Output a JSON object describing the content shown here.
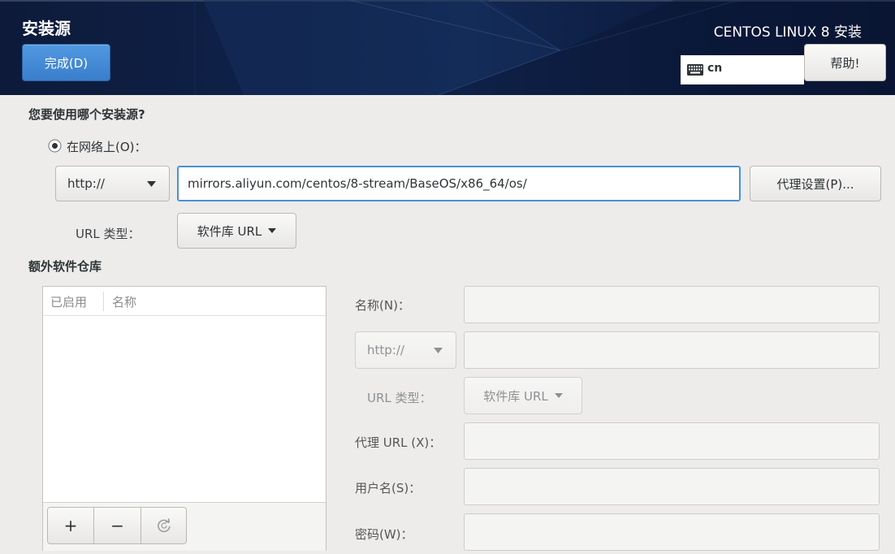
{
  "header": {
    "title": "安装源",
    "done_button": "完成(D)",
    "product_title": "CENTOS LINUX 8 安装",
    "keyboard_layout": "cn",
    "help_button": "帮助!"
  },
  "source": {
    "question": "您要使用哪个安装源?",
    "network_option": {
      "label": "在网络上(O)：",
      "selected": true
    },
    "protocol": "http://",
    "url": "mirrors.aliyun.com/centos/8-stream/BaseOS/x86_64/os/",
    "proxy_button": "代理设置(P)...",
    "url_type_label": "URL 类型：",
    "url_type": "软件库 URL"
  },
  "additional_repos": {
    "title": "额外软件仓库",
    "columns": [
      "已启用",
      "名称"
    ],
    "rows": [],
    "add_button": "+",
    "remove_button": "−"
  },
  "repo_form": {
    "enabled": false,
    "name_label": "名称(N)：",
    "name_value": "",
    "protocol": "http://",
    "url_value": "",
    "url_type_label": "URL 类型：",
    "url_type": "软件库 URL",
    "proxy_url_label": "代理 URL (X)：",
    "proxy_url_value": "",
    "username_label": "用户名(S)：",
    "username_value": "",
    "password_label": "密码(W)：",
    "password_value": ""
  },
  "icons": {
    "keyboard": "keyboard-icon",
    "radio": "radio-checked-icon",
    "dropdown": "pan-down-icon",
    "refresh": "view-refresh-icon"
  },
  "colors": {
    "header_background": "#0f2148",
    "accent": "#4a90d9",
    "window_background": "#edeceb",
    "disabled_text": "#8e9192"
  }
}
